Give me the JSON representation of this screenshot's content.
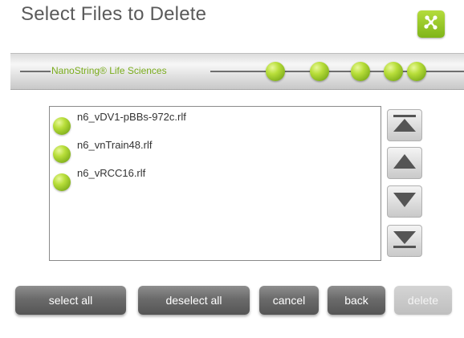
{
  "header": {
    "title": "Select Files to Delete",
    "logo_icon": "network-nodes-icon"
  },
  "banner": {
    "brand": "NanoString® Life Sciences",
    "progress_dots": 5,
    "dot_color": "#9cc82a"
  },
  "file_list": {
    "items": [
      {
        "name": "n6_vDV1-pBBs-972c.rlf"
      },
      {
        "name": "n6_vnTrain48.rlf"
      },
      {
        "name": "n6_vRCC16.rlf"
      }
    ]
  },
  "scroll": {
    "buttons": [
      "scroll-top-icon",
      "scroll-up-icon",
      "scroll-down-icon",
      "scroll-bottom-icon"
    ]
  },
  "actions": {
    "select_all": "select all",
    "deselect_all": "deselect all",
    "cancel": "cancel",
    "back": "back",
    "delete": "delete"
  },
  "colors": {
    "accent_green": "#9cc82a",
    "button_dark": "#6b6b6b",
    "button_disabled": "#c8c8c8"
  }
}
